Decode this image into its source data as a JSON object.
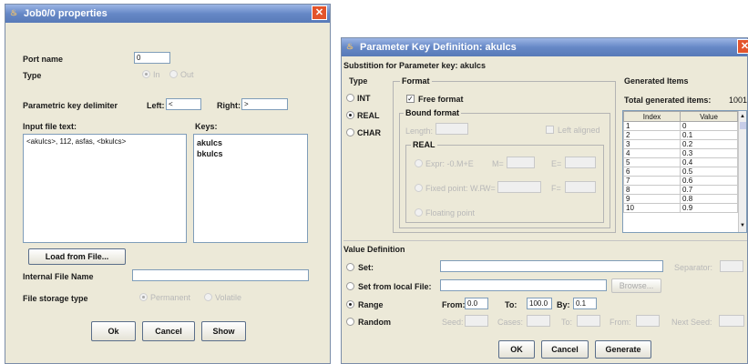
{
  "job": {
    "title": "Job0/0 properties",
    "port_name": {
      "label": "Port name",
      "value": "0"
    },
    "type": {
      "label": "Type",
      "options": [
        "In",
        "Out"
      ],
      "selected": "In"
    },
    "delimiter": {
      "label": "Parametric key delimiter",
      "left_label": "Left:",
      "left_value": "<",
      "right_label": "Right:",
      "right_value": ">"
    },
    "input_label": "Input file text:",
    "input_text": "<akulcs>, 112, asfas, <bkulcs>",
    "keys_label": "Keys:",
    "keys": [
      "akulcs",
      "bkulcs"
    ],
    "load_button": "Load from File...",
    "internal_label": "Internal File Name",
    "internal_value": "",
    "storage": {
      "label": "File storage type",
      "options": [
        "Permanent",
        "Volatile"
      ]
    },
    "buttons": {
      "ok": "Ok",
      "cancel": "Cancel",
      "show": "Show"
    }
  },
  "param": {
    "title": "Parameter Key Definition: akulcs",
    "subtitle": "Substition for Parameter key: akulcs",
    "type": {
      "label": "Type",
      "options": [
        "INT",
        "REAL",
        "CHAR"
      ],
      "selected": "REAL"
    },
    "format": {
      "label": "Format",
      "free_format": "Free format",
      "bound_label": "Bound format",
      "length_label": "Length:",
      "left_aligned": "Left aligned",
      "real_label": "REAL",
      "expr": "Expr: -0.M+E",
      "m_label": "M=",
      "e_label": "E=",
      "fixed": "Fixed point: W.F",
      "w_label": "W=",
      "f_label": "F=",
      "floating": "Floating point"
    },
    "generated": {
      "label": "Generated Items",
      "total_label": "Total generated items:",
      "total": "1001",
      "columns": [
        "Index",
        "Value"
      ],
      "rows": [
        [
          "1",
          "0"
        ],
        [
          "2",
          "0.1"
        ],
        [
          "3",
          "0.2"
        ],
        [
          "4",
          "0.3"
        ],
        [
          "5",
          "0.4"
        ],
        [
          "6",
          "0.5"
        ],
        [
          "7",
          "0.6"
        ],
        [
          "8",
          "0.7"
        ],
        [
          "9",
          "0.8"
        ],
        [
          "10",
          "0.9"
        ]
      ]
    },
    "value_def": {
      "label": "Value Definition",
      "set": "Set:",
      "separator": "Separator:",
      "set_local": "Set from local File:",
      "browse": "Browse...",
      "range": "Range",
      "from_label": "From:",
      "from_value": "0.0",
      "to_label": "To:",
      "to_value": "100.0",
      "by_label": "By:",
      "by_value": "0.1",
      "random": "Random",
      "seed": "Seed:",
      "cases": "Cases:",
      "to2": "To:",
      "from2": "From:",
      "next_seed": "Next Seed:",
      "selected": "Range"
    },
    "buttons": {
      "ok": "OK",
      "cancel": "Cancel",
      "generate": "Generate"
    }
  }
}
